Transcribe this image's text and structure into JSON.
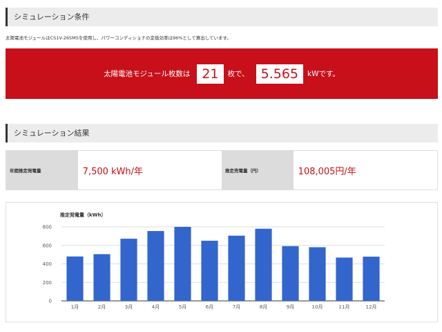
{
  "conditions": {
    "header": "シミュレーション条件",
    "note": "太陽電池モジュールはCS1V-265MSを使用し、パワーコンディショナの変換効率は96%として算出しています。",
    "banner": {
      "prefix": "太陽電池モジュール枚数は",
      "panel_count": "21",
      "middle": "枚で、",
      "capacity": "5.565",
      "suffix": "kWです。"
    }
  },
  "results": {
    "header": "シミュレーション結果",
    "annual_label": "年間推定発電量",
    "annual_value": "7,500 kWh/年",
    "yen_label": "推定売電量（円）",
    "yen_value": "108,005円/年"
  },
  "colors": {
    "accent_red": "#c8101a",
    "bar_blue": "#3366cc"
  },
  "chart_data": {
    "type": "bar",
    "title": "推定発電量（kWh）",
    "categories": [
      "1月",
      "2月",
      "3月",
      "4月",
      "5月",
      "6月",
      "7月",
      "8月",
      "9月",
      "10月",
      "11月",
      "12月"
    ],
    "values": [
      480,
      505,
      672,
      755,
      800,
      650,
      705,
      780,
      592,
      580,
      468,
      478
    ],
    "yticks": [
      "0",
      "200",
      "400",
      "600",
      "800"
    ],
    "ylim": [
      0,
      800
    ],
    "grid": true
  }
}
